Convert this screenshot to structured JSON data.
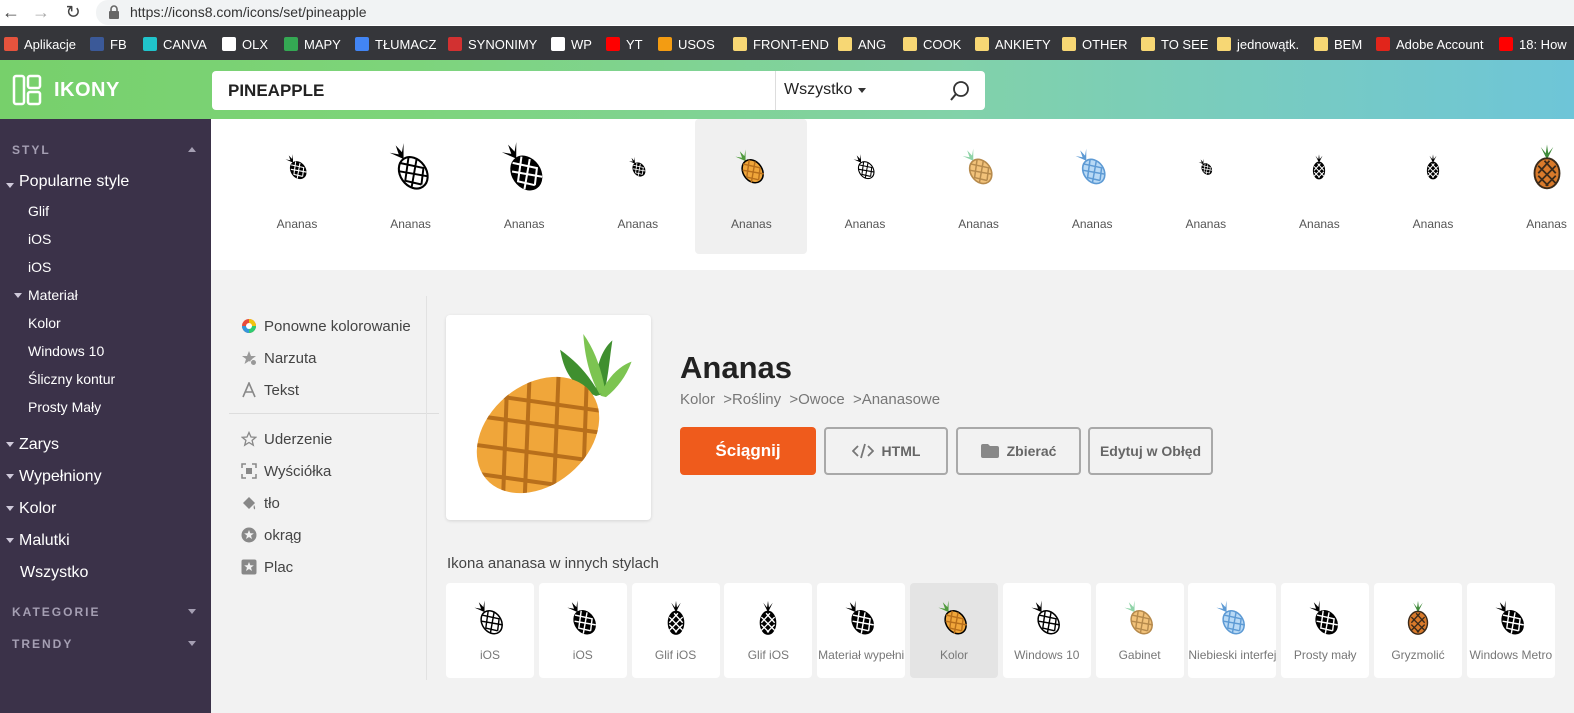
{
  "browser": {
    "url": "https://icons8.com/icons/set/pineapple",
    "bookmarks": [
      {
        "label": "Aplikacje",
        "icon": "apps-grid-icon",
        "color": "#e5533d"
      },
      {
        "label": "FB",
        "icon": "facebook-icon",
        "color": "#3b5998"
      },
      {
        "label": "CANVA",
        "icon": "canva-icon",
        "color": "#20c4cb"
      },
      {
        "label": "OLX",
        "icon": "olx-icon",
        "color": "#ffffff"
      },
      {
        "label": "MAPY",
        "icon": "maps-icon",
        "color": "#34a853"
      },
      {
        "label": "TŁUMACZ",
        "icon": "translate-icon",
        "color": "#4285f4"
      },
      {
        "label": "SYNONIMY",
        "icon": "synonyms-icon",
        "color": "#d23131"
      },
      {
        "label": "WP",
        "icon": "wp-icon",
        "color": "#ffffff"
      },
      {
        "label": "YT",
        "icon": "youtube-icon",
        "color": "#ff0000"
      },
      {
        "label": "USOS",
        "icon": "usos-icon",
        "color": "#f39c12"
      },
      {
        "label": "FRONT-END",
        "icon": "folder-icon",
        "color": "#f7d774"
      },
      {
        "label": "ANG",
        "icon": "folder-icon",
        "color": "#f7d774"
      },
      {
        "label": "COOK",
        "icon": "folder-icon",
        "color": "#f7d774"
      },
      {
        "label": "ANKIETY",
        "icon": "folder-icon",
        "color": "#f7d774"
      },
      {
        "label": "OTHER",
        "icon": "folder-icon",
        "color": "#f7d774"
      },
      {
        "label": "TO SEE",
        "icon": "folder-icon",
        "color": "#f7d774"
      },
      {
        "label": "jednowątk.",
        "icon": "folder-icon",
        "color": "#f7d774"
      },
      {
        "label": "BEM",
        "icon": "folder-icon",
        "color": "#f7d774"
      },
      {
        "label": "Adobe Account",
        "icon": "adobe-icon",
        "color": "#e1251b"
      },
      {
        "label": "18: How",
        "icon": "youtube-icon",
        "color": "#ff0000"
      }
    ]
  },
  "header": {
    "logo": "IKONY",
    "search_value": "PINEAPPLE",
    "filter": "Wszystko"
  },
  "sidebar": {
    "style_heading": "STYL",
    "popular": "Popularne style",
    "glif": "Glif",
    "ios1": "iOS",
    "ios2": "iOS",
    "material": "Materiał",
    "kolor_sub": "Kolor",
    "windows10": "Windows 10",
    "sliczny": "Śliczny kontur",
    "prosty": "Prosty Mały",
    "zarys": "Zarys",
    "wypelniony": "Wypełniony",
    "kolor": "Kolor",
    "malutki": "Malutki",
    "wszystko": "Wszystko",
    "kategorie": "KATEGORIE",
    "trendy": "TRENDY"
  },
  "strip": {
    "items": [
      {
        "label": "Ananas",
        "style": "filled"
      },
      {
        "label": "Ananas",
        "style": "outline"
      },
      {
        "label": "Ananas",
        "style": "filled"
      },
      {
        "label": "Ananas",
        "style": "filled"
      },
      {
        "label": "Ananas",
        "style": "color"
      },
      {
        "label": "Ananas",
        "style": "outline"
      },
      {
        "label": "Ananas",
        "style": "color-light"
      },
      {
        "label": "Ananas",
        "style": "blue"
      },
      {
        "label": "Ananas",
        "style": "filled"
      },
      {
        "label": "Ananas",
        "style": "upright"
      },
      {
        "label": "Ananas",
        "style": "upright"
      },
      {
        "label": "Ananas",
        "style": "doodle"
      }
    ]
  },
  "tools": {
    "recolor": "Ponowne kolorowanie",
    "overlay": "Narzuta",
    "text": "Tekst",
    "stroke": "Uderzenie",
    "padding": "Wyściółka",
    "background": "tło",
    "circle": "okrąg",
    "square": "Plac"
  },
  "detail": {
    "title": "Ananas",
    "breadcrumb": [
      "Kolor",
      ">Rośliny",
      ">Owoce",
      ">Ananasowe"
    ],
    "download": "Ściągnij",
    "html": "HTML",
    "collect": "Zbierać",
    "edit": "Edytuj w Obłęd"
  },
  "other_styles": {
    "title": "Ikona ananasa w innych stylach",
    "items": [
      {
        "label": "iOS",
        "style": "outline"
      },
      {
        "label": "iOS",
        "style": "filled"
      },
      {
        "label": "Glif iOS",
        "style": "upright"
      },
      {
        "label": "Glif iOS",
        "style": "upright"
      },
      {
        "label": "Materiał wypełni",
        "style": "filled"
      },
      {
        "label": "Kolor",
        "style": "color"
      },
      {
        "label": "Windows 10",
        "style": "outline"
      },
      {
        "label": "Gabinet",
        "style": "color-light"
      },
      {
        "label": "Niebieski interfej",
        "style": "blue"
      },
      {
        "label": "Prosty mały",
        "style": "filled"
      },
      {
        "label": "Gryzmolić",
        "style": "doodle"
      },
      {
        "label": "Windows Metro",
        "style": "filled"
      }
    ]
  },
  "colors": {
    "accent_orange": "#ef5b1c",
    "sidebar_bg": "#3b3249",
    "pineapple_body": "#f0a63a",
    "pineapple_leaf": "#4f9a3c"
  }
}
